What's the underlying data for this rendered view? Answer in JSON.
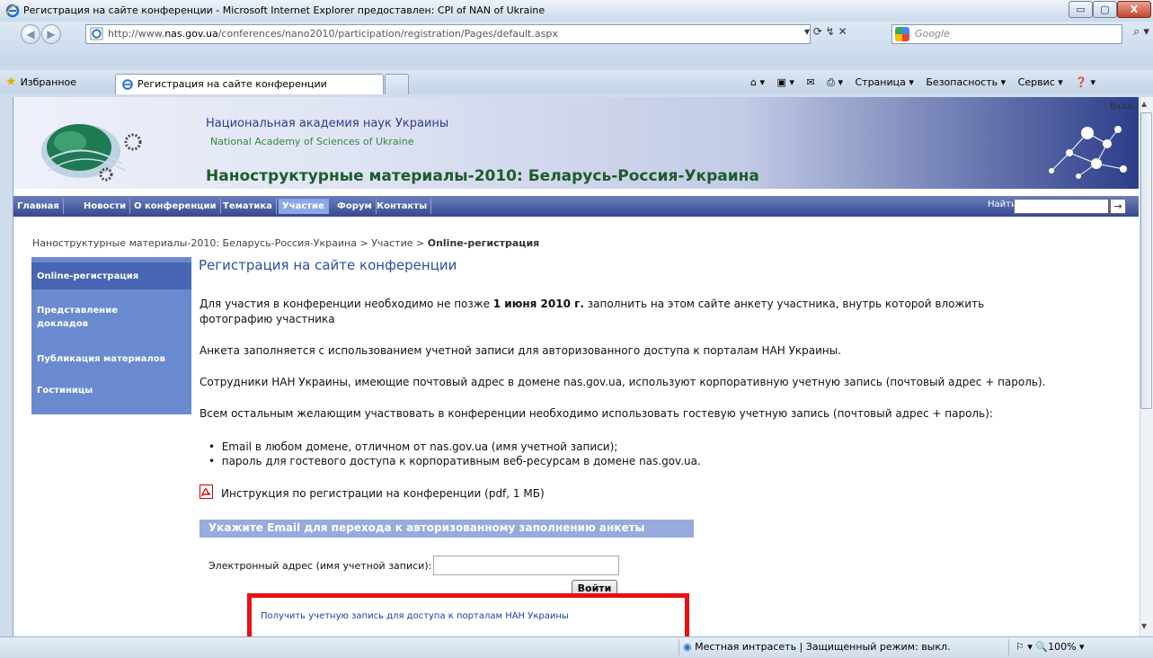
{
  "window": {
    "title": "Регистрация на сайте конференции - Microsoft Internet Explorer предоставлен: CPI of NAN of Ukraine",
    "min_glyph": "▭",
    "max_glyph": "▢",
    "close_glyph": "X"
  },
  "address_bar": {
    "url_prefix": "http://www.",
    "url_host": "nas.gov.ua",
    "url_path": "/conferences/nano2010/participation/registration/Pages/default.aspx",
    "tools": "▾  ⟳  ↯  ✕"
  },
  "search": {
    "placeholder": "Google",
    "go_glyph": "⌕ ▾"
  },
  "tabs": {
    "favorites_label": "Избранное",
    "active_tab_label": "Регистрация на сайте конференции"
  },
  "command_bar": {
    "home": "⌂ ▾",
    "feeds": "▣ ▾",
    "mail": "✉",
    "print": "⎙ ▾",
    "page": "Страница ▾",
    "safety": "Безопасность ▾",
    "tools": "Сервис ▾",
    "help": "❓ ▾"
  },
  "site": {
    "login": "Вход",
    "org_ru": "Национальная академия наук Украины",
    "org_en": "National Academy of Sciences of Ukraine",
    "conference_title": "Наноструктурные материалы-2010: Беларусь-Россия-Украина",
    "nav": [
      "Главная",
      "Новости",
      "О конференции",
      "Тематика",
      "Участие",
      "Форум",
      "Контакты"
    ],
    "nav_active_index": 4,
    "find_label": "Найти",
    "find_go": "→"
  },
  "breadcrumb": {
    "part1": "Наноструктурные материалы-2010: Беларусь-Россия-Украина",
    "sep": " > ",
    "part2": "Участие",
    "current": "Online-регистрация"
  },
  "left_nav": [
    "Online-регистрация",
    "Представление докладов",
    "Публикация материалов",
    "Гостиницы"
  ],
  "content": {
    "title": "Регистрация на сайте конференции",
    "p1_a": "Для участия в конференции необходимо не позже ",
    "p1_bold": "1 июня 2010 г.",
    "p1_b": " заполнить на этом сайте анкету участника, внутрь которой вложить",
    "p1_c": "фотографию участника",
    "p2": "Анкета заполняется с использованием учетной записи для авторизованного доступа к порталам НАН Украины.",
    "p3": "Сотрудники НАН Украины, имеющие почтовый адрес в домене nas.gov.ua, используют корпоративную учетную запись (почтовый адрес + пароль).",
    "p4": "Всем остальным желающим участвовать в конференции необходимо использовать гостевую учетную запись (почтовый адрес + пароль):",
    "bullets": [
      "Email в любом домене, отличном от nas.gov.ua (имя учетной записи);",
      "пароль для гостевого доступа к корпоративным веб-ресурсам в домене nas.gov.ua."
    ],
    "pdf_link": "Инструкция по регистрации на конференции (pdf, 1 МБ)",
    "form_header": "Укажите Email для перехода к авторизованному заполнению анкеты",
    "email_label": "Электронный адрес (имя учетной записи):",
    "email_value": "",
    "login_button": "Войти",
    "get_account_link": "Получить учетную запись для доступа к порталам НАН Украины"
  },
  "status_bar": {
    "zone": "Местная интрасеть | Защищенный режим: выкл.",
    "zoom": "⚐ ▾   🔍100%  ▾"
  },
  "colors": {
    "highlight_box": "#e81010",
    "nav_bar": "#36488f",
    "left_nav": "#6a8ad0"
  }
}
